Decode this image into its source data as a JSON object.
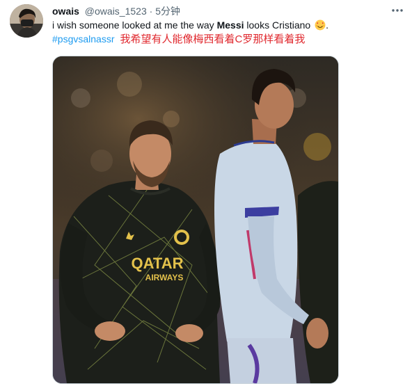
{
  "tweet": {
    "display_name": "owais",
    "handle": "@owais_1523",
    "separator": "·",
    "time": "5分钟",
    "text_before": "i wish someone looked at me the way ",
    "text_bold1": "Messi",
    "text_middle": " looks Cristiano ",
    "text_after": ".",
    "emoji_icon": "smiling-face-with-heart-eyes-icon",
    "hashtag": "#psgvsalnassr",
    "caption_cn": "我希望有人能像梅西看着C罗那样看着我",
    "more_icon": "more-horizontal-icon"
  },
  "media": {
    "jersey_sponsor_line1": "QATAR",
    "jersey_sponsor_line2": "AIRWAYS",
    "player_left_shirt_color": "#1c1f1a",
    "player_right_shirt_color": "#c9d7e6",
    "sponsor_color": "#e3c14b"
  },
  "colors": {
    "link": "#1d9bf0",
    "caption_red": "#e0282e",
    "secondary_text": "#536471"
  }
}
